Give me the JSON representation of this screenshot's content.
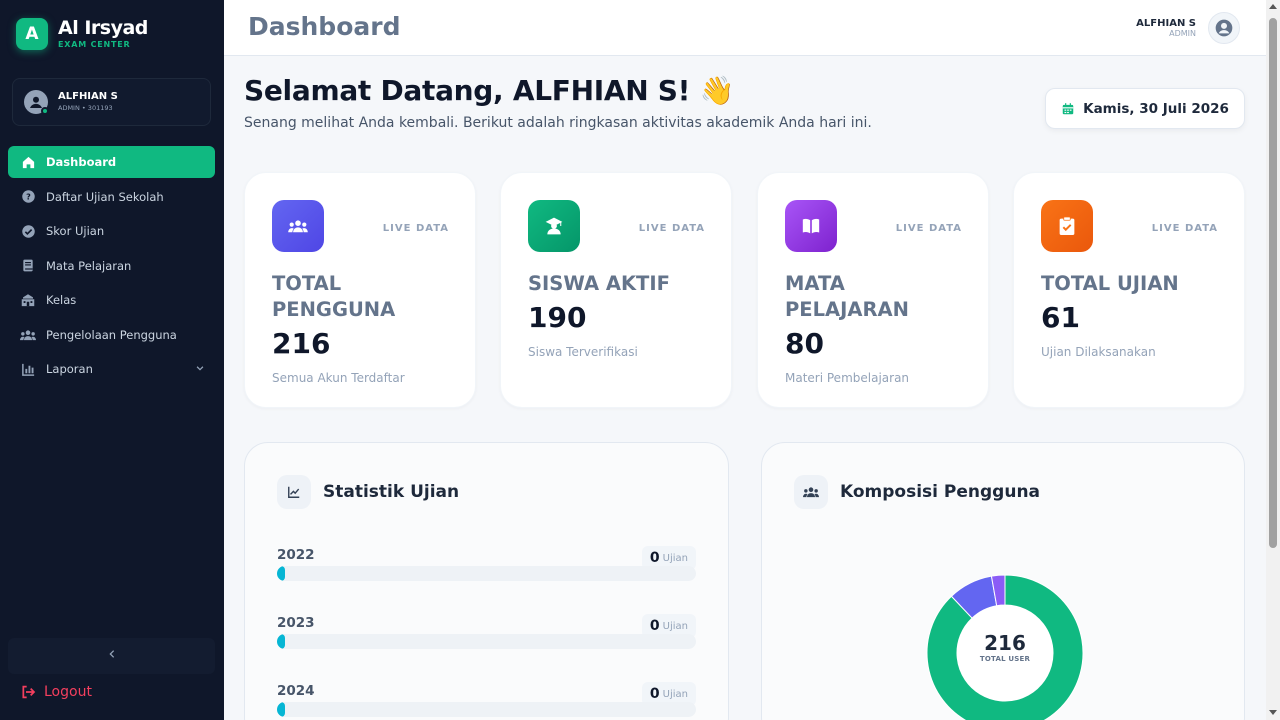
{
  "brand": {
    "logo_letter": "A",
    "name": "Al Irsyad",
    "subtitle": "EXAM CENTER"
  },
  "sidebar_user": {
    "name": "ALFHIAN S",
    "meta": "ADMIN • 301193"
  },
  "nav": [
    {
      "label": "Dashboard",
      "icon": "home-icon",
      "active": true
    },
    {
      "label": "Daftar Ujian Sekolah",
      "icon": "question-circle-icon"
    },
    {
      "label": "Skor Ujian",
      "icon": "check-circle-icon"
    },
    {
      "label": "Mata Pelajaran",
      "icon": "book-icon"
    },
    {
      "label": "Kelas",
      "icon": "school-icon"
    },
    {
      "label": "Pengelolaan Pengguna",
      "icon": "users-icon"
    },
    {
      "label": "Laporan",
      "icon": "bar-chart-icon",
      "has_submenu": true
    }
  ],
  "logout_label": "Logout",
  "header": {
    "title": "Dashboard",
    "user_name": "ALFHIAN S",
    "user_role": "ADMIN"
  },
  "welcome": {
    "title": "Selamat Datang, ALFHIAN S! 👋",
    "subtitle": "Senang melihat Anda kembali. Berikut adalah ringkasan aktivitas akademik Anda hari ini."
  },
  "date_label": "Kamis, 30 Juli 2026",
  "stats": [
    {
      "label": "TOTAL PENGGUNA",
      "value": "216",
      "desc": "Semua Akun Terdaftar",
      "badge": "LIVE DATA",
      "icon": "users-icon",
      "color": "#5b5ff0"
    },
    {
      "label": "SISWA AKTIF",
      "value": "190",
      "desc": "Siswa Terverifikasi",
      "badge": "LIVE DATA",
      "icon": "graduate-icon",
      "color": "#10b981"
    },
    {
      "label": "MATA PELAJARAN",
      "value": "80",
      "desc": "Materi Pembelajaran",
      "badge": "LIVE DATA",
      "icon": "book-open-icon",
      "color": "#9333ea"
    },
    {
      "label": "TOTAL UJIAN",
      "value": "61",
      "desc": "Ujian Dilaksanakan",
      "badge": "LIVE DATA",
      "icon": "clipboard-check-icon",
      "color": "#f97316"
    }
  ],
  "exam_stats": {
    "title": "Statistik Ujian",
    "unit": "Ujian",
    "rows": [
      {
        "year": "2022",
        "count": "0",
        "fraction": 0
      },
      {
        "year": "2023",
        "count": "0",
        "fraction": 0
      },
      {
        "year": "2024",
        "count": "0",
        "fraction": 0
      }
    ]
  },
  "user_composition": {
    "title": "Komposisi Pengguna",
    "total": "216",
    "total_label": "TOTAL USER"
  },
  "chart_data": {
    "type": "pie",
    "title": "Komposisi Pengguna",
    "series": [
      {
        "value": 190,
        "color": "#10b981"
      },
      {
        "value": 20,
        "color": "#6366f1"
      },
      {
        "value": 6,
        "color": "#8b5cf6"
      }
    ]
  }
}
